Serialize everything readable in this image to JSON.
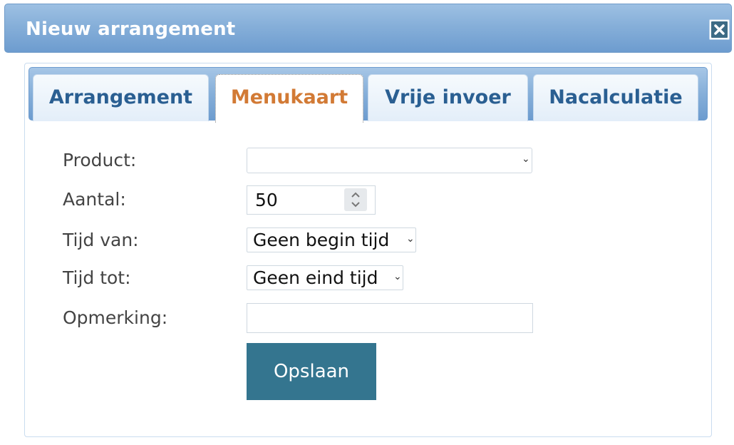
{
  "dialog": {
    "title": "Nieuw arrangement"
  },
  "tabs": [
    {
      "label": "Arrangement",
      "active": false
    },
    {
      "label": "Menukaart",
      "active": true
    },
    {
      "label": "Vrije invoer",
      "active": false
    },
    {
      "label": "Nacalculatie",
      "active": false
    }
  ],
  "form": {
    "product": {
      "label": "Product:",
      "value": ""
    },
    "aantal": {
      "label": "Aantal:",
      "value": "50"
    },
    "tijd_van": {
      "label": "Tijd van:",
      "value": "Geen begin tijd"
    },
    "tijd_tot": {
      "label": "Tijd tot:",
      "value": "Geen eind tijd"
    },
    "opmerking": {
      "label": "Opmerking:",
      "value": ""
    },
    "save_label": "Opslaan"
  },
  "colors": {
    "accent": "#34758f",
    "active_tab_text": "#d27a35",
    "tab_text": "#2a5f92",
    "header": "#86afd9"
  },
  "icons": {
    "close": "close-icon",
    "dropdown": "chevron-down-icon",
    "stepper": "stepper-icon"
  }
}
